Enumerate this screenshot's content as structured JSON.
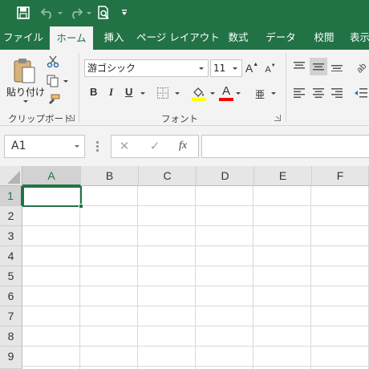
{
  "quick_access": {
    "save_icon": "save-icon",
    "undo_icon": "undo-icon",
    "redo_icon": "redo-icon",
    "print_preview_icon": "print-preview-icon",
    "customize_icon": "customize-qat-icon"
  },
  "tabs": [
    {
      "label": "ファイル",
      "active": false
    },
    {
      "label": "ホーム",
      "active": true
    },
    {
      "label": "挿入",
      "active": false
    },
    {
      "label": "ページ レイアウト",
      "active": false
    },
    {
      "label": "数式",
      "active": false
    },
    {
      "label": "データ",
      "active": false
    },
    {
      "label": "校閲",
      "active": false
    },
    {
      "label": "表示",
      "active": false
    }
  ],
  "ribbon": {
    "clipboard": {
      "paste_label": "貼り付け",
      "group_label": "クリップボード"
    },
    "font": {
      "font_name": "游ゴシック",
      "font_size": "11",
      "bold": "B",
      "italic": "I",
      "underline": "U",
      "grow_font": "A",
      "shrink_font": "A",
      "font_color_letter": "A",
      "phonetic_letter": "亜",
      "group_label": "フォント"
    }
  },
  "formula_bar": {
    "name_box": "A1",
    "cancel": "✕",
    "enter": "✓",
    "fx": "fx",
    "value": ""
  },
  "grid": {
    "columns": [
      "A",
      "B",
      "C",
      "D",
      "E",
      "F"
    ],
    "rows": [
      "1",
      "2",
      "3",
      "4",
      "5",
      "6",
      "7",
      "8",
      "9"
    ],
    "active_cell": "A1"
  },
  "colors": {
    "accent": "#217346",
    "highlight_yellow": "#ffff00",
    "font_red": "#ff0000"
  }
}
